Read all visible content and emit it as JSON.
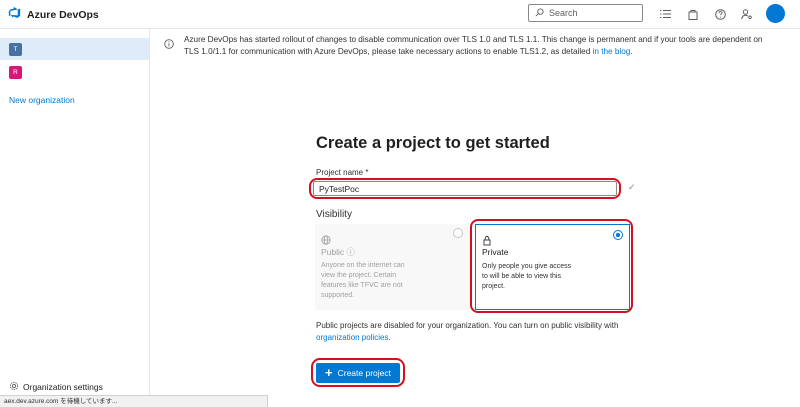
{
  "app": {
    "title": "Azure DevOps"
  },
  "search": {
    "placeholder": "Search"
  },
  "top_icons": [
    "list-icon",
    "bag-icon",
    "help-icon",
    "user-settings-icon"
  ],
  "sidebar": {
    "orgs": [
      {
        "initial": "T",
        "color": "#4a6fa5",
        "active": true
      },
      {
        "initial": "R",
        "color": "#d9157a",
        "active": false
      }
    ],
    "new_org_label": "New organization",
    "settings_label": "Organization settings"
  },
  "banner": {
    "text": "Azure DevOps has started rollout of changes to disable communication over TLS 1.0 and TLS 1.1. This change is permanent and if your tools are dependent on TLS 1.0/1.1 for communication with Azure DevOps, please take necessary actions to enable TLS1.2, as detailed ",
    "link_text": "in the blog",
    "suffix": "."
  },
  "form": {
    "title": "Create a project to get started",
    "project_name_label": "Project name *",
    "project_name_value": "PyTestPoc",
    "visibility_label": "Visibility",
    "public": {
      "title": "Public",
      "description": "Anyone on the internet can view the project. Certain features like TFVC are not supported.",
      "selected": false
    },
    "private": {
      "title": "Private",
      "description": "Only people you give access to will be able to view this project.",
      "selected": true
    },
    "notice_text": "Public projects are disabled for your organization. You can turn on public visibility with ",
    "notice_link": "organization policies",
    "notice_suffix": ".",
    "create_button_label": "Create project"
  },
  "status_bar": {
    "text": "aex.dev.azure.com を待機しています..."
  },
  "colors": {
    "accent": "#0078d4",
    "highlight": "#d1111f"
  }
}
